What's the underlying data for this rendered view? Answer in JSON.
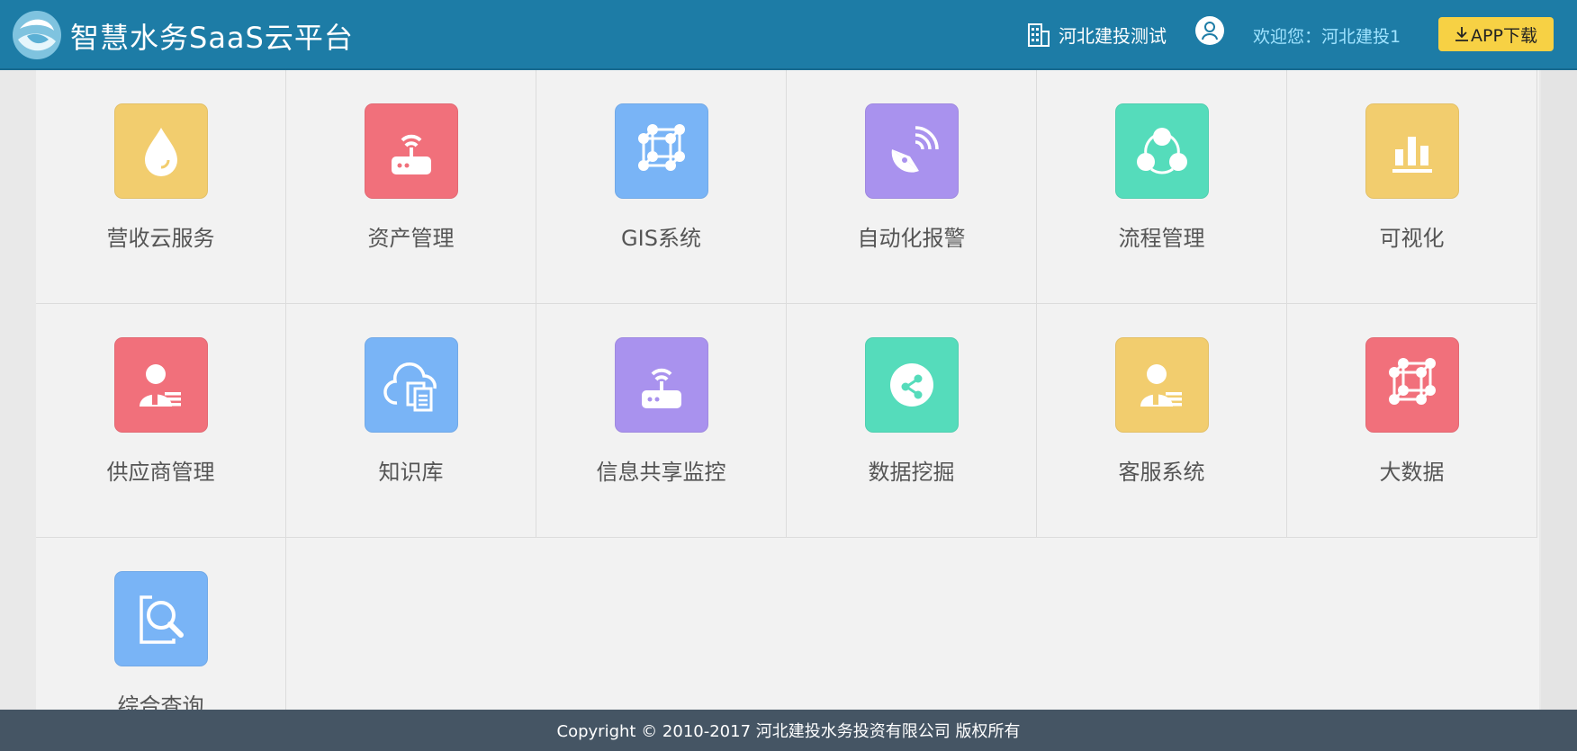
{
  "header": {
    "title": "智慧水务SaaS云平台",
    "org_name": "河北建投测试",
    "welcome_label": "欢迎您：河北建投1",
    "app_download_label": "APP下载",
    "bg_color": "#1d7ca6"
  },
  "tiles": [
    {
      "label": "营收云服务",
      "icon": "water-drop-icon",
      "color": "#f2cd6e"
    },
    {
      "label": "资产管理",
      "icon": "router-icon",
      "color": "#f1707b"
    },
    {
      "label": "GIS系统",
      "icon": "network-cube-icon",
      "color": "#79b4f6"
    },
    {
      "label": "自动化报警",
      "icon": "satellite-dish-icon",
      "color": "#a992ee"
    },
    {
      "label": "流程管理",
      "icon": "flow-circles-icon",
      "color": "#55dcbb"
    },
    {
      "label": "可视化",
      "icon": "bar-chart-icon",
      "color": "#f2cd6e"
    },
    {
      "label": "供应商管理",
      "icon": "supplier-user-icon",
      "color": "#f1707b"
    },
    {
      "label": "知识库",
      "icon": "cloud-docs-icon",
      "color": "#79b4f6"
    },
    {
      "label": "信息共享监控",
      "icon": "router-icon",
      "color": "#a992ee"
    },
    {
      "label": "数据挖掘",
      "icon": "share-circle-icon",
      "color": "#55dcbb"
    },
    {
      "label": "客服系统",
      "icon": "service-user-icon",
      "color": "#f2cd6e"
    },
    {
      "label": "大数据",
      "icon": "network-cube-icon",
      "color": "#f1707b"
    },
    {
      "label": "综合查询",
      "icon": "search-doc-icon",
      "color": "#79b4f6"
    }
  ],
  "footer": {
    "copyright": "Copyright © 2010-2017 河北建投水务投资有限公司 版权所有",
    "bg_color": "#455564"
  }
}
